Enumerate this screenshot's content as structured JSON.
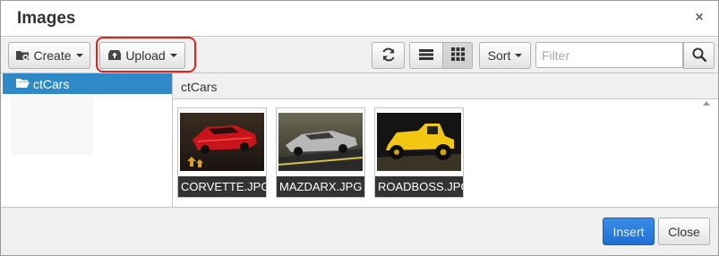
{
  "dialog": {
    "title": "Images",
    "close_symbol": "×"
  },
  "toolbar": {
    "create_label": "Create",
    "upload_label": "Upload",
    "sort_label": "Sort",
    "filter_placeholder": "Filter",
    "icons": {
      "create": "folder-plus-icon",
      "upload": "upload-icon",
      "refresh": "refresh-icon",
      "list_view": "list-view-icon",
      "grid_view": "grid-view-icon",
      "search": "search-icon"
    },
    "annotation_color": "#d9251c"
  },
  "sidebar": {
    "items": [
      {
        "label": "ctCars",
        "selected": true,
        "icon": "folder-open-icon"
      }
    ],
    "selected_color": "#2d8ac7"
  },
  "content": {
    "path": "ctCars",
    "files": [
      {
        "name": "CORVETTE.JPG",
        "image": "red sports car (Corvette) on dark background"
      },
      {
        "name": "MAZDARX.JPG",
        "image": "silver concept car on road"
      },
      {
        "name": "ROADBOSS.JPG",
        "image": "yellow hot rod on dark background"
      }
    ]
  },
  "footer": {
    "insert_label": "Insert",
    "close_label": "Close",
    "insert_color": "#2f7ed8"
  }
}
